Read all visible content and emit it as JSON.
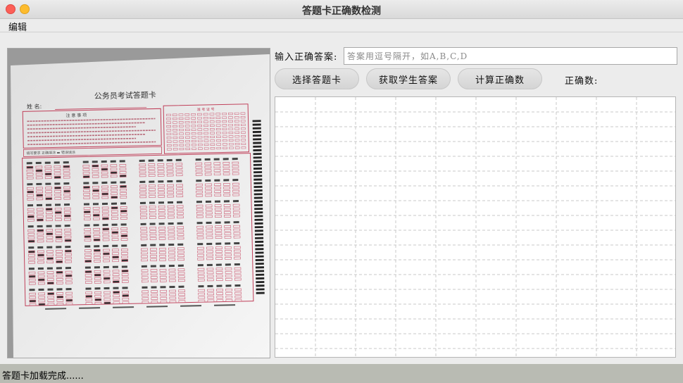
{
  "window": {
    "title": "答题卡正确数检测",
    "controls": [
      "close",
      "minimize"
    ]
  },
  "menu": {
    "items": [
      {
        "label": "编辑"
      }
    ]
  },
  "answer_sheet": {
    "title": "公务员考试答题卡",
    "name_label": "姓  名:",
    "notice_title": "注 意 事 项",
    "id_title": "准 考 证 号",
    "fill_hint": "填写要求  正确填涂  ▬  错误填涂"
  },
  "form": {
    "answer_label": "输入正确答案:",
    "answer_placeholder": "答案用逗号隔开，如A,B,C,D",
    "answer_value": ""
  },
  "buttons": {
    "select_sheet": "选择答题卡",
    "get_answers": "获取学生答案",
    "calc_correct": "计算正确数"
  },
  "result": {
    "correct_label": "正确数:"
  },
  "status": {
    "text": "答题卡加载完成......"
  }
}
